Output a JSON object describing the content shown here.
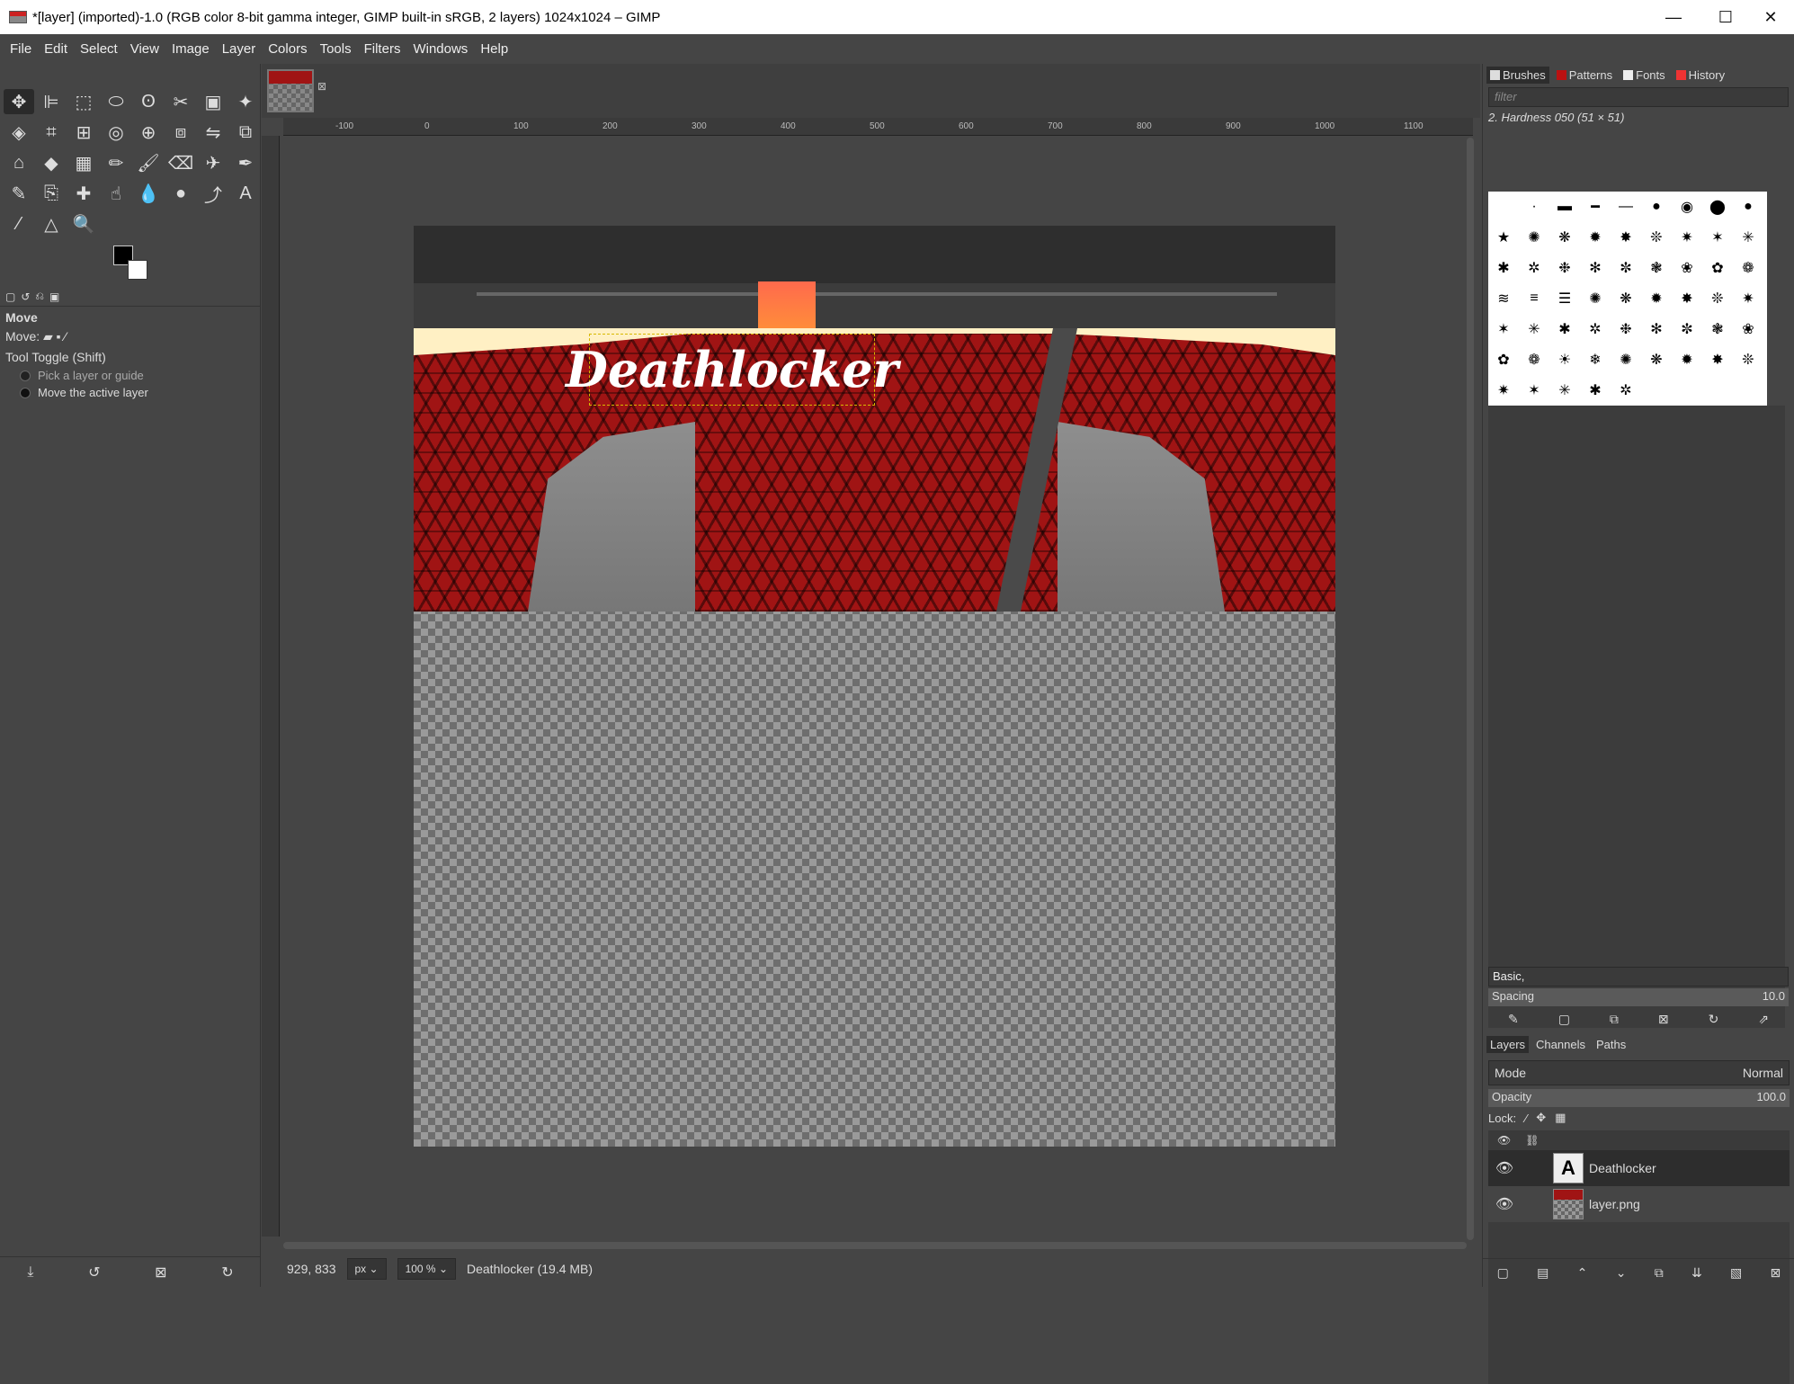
{
  "window": {
    "title": "*[layer] (imported)-1.0 (RGB color 8-bit gamma integer, GIMP built-in sRGB, 2 layers) 1024x1024 – GIMP",
    "minimize": "—",
    "maximize": "☐",
    "close": "✕"
  },
  "menu": [
    "File",
    "Edit",
    "Select",
    "View",
    "Image",
    "Layer",
    "Colors",
    "Tools",
    "Filters",
    "Windows",
    "Help"
  ],
  "tools": [
    "move-icon",
    "align-icon",
    "rect-select-icon",
    "ellipse-select-icon",
    "free-select-icon",
    "scissors-icon",
    "foreground-select-icon",
    "fuzzy-select-icon",
    "select-by-color-icon",
    "crop-icon",
    "unified-transform-icon",
    "warp-transform-icon",
    "handle-transform-icon",
    "perspective-icon",
    "flip-icon",
    "3d-transform-icon",
    "cage-icon",
    "bucket-fill-icon",
    "gradient-icon",
    "pencil-icon",
    "paintbrush-icon",
    "eraser-icon",
    "airbrush-icon",
    "ink-icon",
    "mypaint-icon",
    "clone-icon",
    "heal-icon",
    "smudge-icon",
    "blur-icon",
    "dodge-icon",
    "paths-icon",
    "text-icon",
    "color-picker-icon",
    "measure-icon",
    "zoom-icon"
  ],
  "tool_glyphs": [
    "✥",
    "⊫",
    "⬚",
    "⬭",
    "ʘ",
    "✂",
    "▣",
    "✦",
    "◈",
    "⌗",
    "⊞",
    "◎",
    "⊕",
    "⧈",
    "⇋",
    "⧉",
    "⌂",
    "◆",
    "▦",
    "✏",
    "🖌",
    "⌫",
    "✈",
    "✒",
    "✎",
    "⎘",
    "✚",
    "☝",
    "💧",
    "●",
    "⤴",
    "A",
    "⁄",
    "△",
    "🔍"
  ],
  "tool_options": {
    "title": "Move",
    "move_label": "Move:",
    "toggle_label": "Tool Toggle  (Shift)",
    "option1": "Pick a layer or guide",
    "option2": "Move the active layer"
  },
  "canvas": {
    "text": "Deathlocker",
    "ruler_ticks": [
      "-100",
      "0",
      "100",
      "200",
      "300",
      "400",
      "500",
      "600",
      "700",
      "800",
      "900",
      "1000",
      "1100"
    ]
  },
  "status": {
    "coords": "929, 833",
    "unit": "px",
    "zoom": "100 %",
    "info": "Deathlocker (19.4 MB)"
  },
  "brushes": {
    "tabs": [
      "Brushes",
      "Patterns",
      "Fonts",
      "History"
    ],
    "filter_placeholder": "filter",
    "current": "2. Hardness 050 (51 × 51)",
    "set": "Basic,",
    "spacing_label": "Spacing",
    "spacing_value": "10.0"
  },
  "layers": {
    "tabs": [
      "Layers",
      "Channels",
      "Paths"
    ],
    "mode_label": "Mode",
    "mode_value": "Normal",
    "opacity_label": "Opacity",
    "opacity_value": "100.0",
    "lock_label": "Lock:",
    "items": [
      {
        "name": "Deathlocker"
      },
      {
        "name": "layer.png"
      }
    ]
  }
}
